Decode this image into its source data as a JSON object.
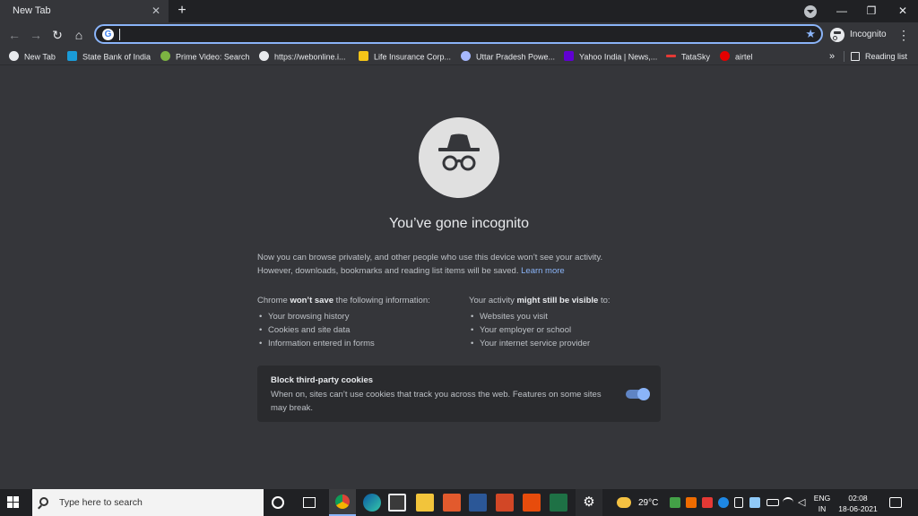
{
  "tab": {
    "title": "New Tab",
    "close": "✕",
    "new_tab": "+"
  },
  "window_controls": {
    "minimize": "—",
    "restore": "❐",
    "close": "✕"
  },
  "toolbar": {
    "back": "←",
    "forward": "→",
    "reload": "↻",
    "home": "⌂",
    "omnibox_value": "",
    "star": "★",
    "profile_label": "Incognito",
    "menu": "⋮"
  },
  "bookmarks": [
    {
      "label": "New Tab",
      "icon_color": "#e8eaed",
      "icon": "globe-icon"
    },
    {
      "label": "State Bank of India",
      "icon_color": "#1a9bd7",
      "icon": "sbi-icon"
    },
    {
      "label": "Prime Video: Search",
      "icon_color": "#7cb342",
      "icon": "play-icon"
    },
    {
      "label": "https://webonline.i...",
      "icon_color": "#e8eaed",
      "icon": "globe-icon"
    },
    {
      "label": "Life Insurance Corp...",
      "icon_color": "#f5c518",
      "icon": "lic-icon"
    },
    {
      "label": "Uttar Pradesh Powe...",
      "icon_color": "#a6b8ff",
      "icon": "uppcl-icon"
    },
    {
      "label": "Yahoo India | News,...",
      "icon_color": "#6001d2",
      "icon": "yahoo-icon"
    },
    {
      "label": "TataSky",
      "icon_color": "#e53935",
      "icon": "tatasky-icon"
    },
    {
      "label": "airtel",
      "icon_color": "#e40000",
      "icon": "airtel-icon"
    }
  ],
  "bookmarks_more": "»",
  "reading_list": "Reading list",
  "incognito": {
    "title": "You’ve gone incognito",
    "intro_line1": "Now you can browse privately, and other people who use this device won’t see your activity.",
    "intro_line2": "However, downloads, bookmarks and reading list items will be saved.",
    "learn_more": "Learn more",
    "left_head_pre": "Chrome ",
    "left_head_bold": "won’t save",
    "left_head_post": " the following information:",
    "left_items": [
      "Your browsing history",
      "Cookies and site data",
      "Information entered in forms"
    ],
    "right_head_pre": "Your activity ",
    "right_head_bold": "might still be visible",
    "right_head_post": " to:",
    "right_items": [
      "Websites you visit",
      "Your employer or school",
      "Your internet service provider"
    ],
    "cookie_title": "Block third-party cookies",
    "cookie_desc": "When on, sites can’t use cookies that track you across the web. Features on some sites may break.",
    "cookie_enabled": true
  },
  "taskbar": {
    "search_placeholder": "Type here to search",
    "weather": "29°C",
    "lang_top": "ENG",
    "lang_bottom": "IN",
    "time": "02:08",
    "date": "18-06-2021"
  },
  "colors": {
    "accent": "#8ab4f8",
    "background": "#35363a",
    "taskbar": "#202124"
  }
}
